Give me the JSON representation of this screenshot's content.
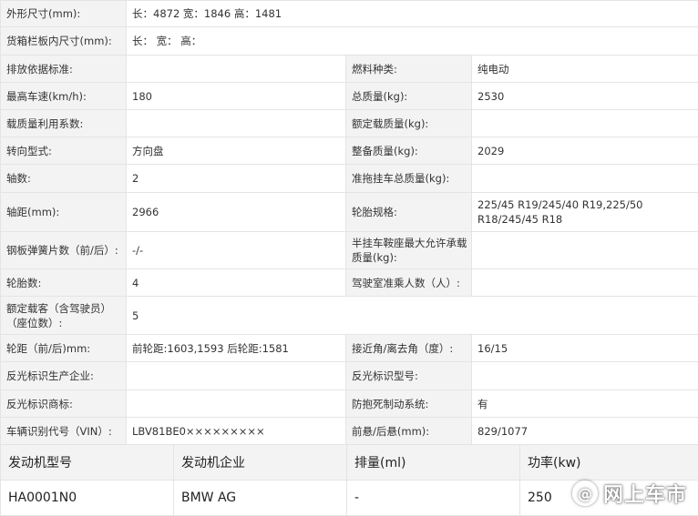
{
  "rows": [
    {
      "k1": "外形尺寸(mm):",
      "v1": "长：4872 宽：1846 高：1481"
    },
    {
      "k1": "货箱栏板内尺寸(mm):",
      "v1": "长： 宽： 高："
    },
    {
      "k1": "排放依据标准:",
      "v1": "",
      "k2": "燃料种类:",
      "v2": "纯电动"
    },
    {
      "k1": "最高车速(km/h):",
      "v1": "180",
      "k2": "总质量(kg):",
      "v2": "2530"
    },
    {
      "k1": "载质量利用系数:",
      "v1": "",
      "k2": "额定载质量(kg):",
      "v2": ""
    },
    {
      "k1": "转向型式:",
      "v1": "方向盘",
      "k2": "整备质量(kg):",
      "v2": "2029"
    },
    {
      "k1": "轴数:",
      "v1": "2",
      "k2": "准拖挂车总质量(kg):",
      "v2": ""
    },
    {
      "k1": "轴距(mm):",
      "v1": "2966",
      "k2": "轮胎规格:",
      "v2": "225/45 R19/245/40 R19,225/50 R18/245/45 R18"
    },
    {
      "k1": "钢板弹簧片数（前/后）:",
      "v1": "-/-",
      "k2": "半挂车鞍座最大允许承载质量(kg):",
      "v2": ""
    },
    {
      "k1": "轮胎数:",
      "v1": "4",
      "k2": "驾驶室准乘人数（人）:",
      "v2": ""
    },
    {
      "k1": "额定载客（含驾驶员）（座位数）:",
      "v1": "5"
    },
    {
      "k1": "轮距（前/后)mm:",
      "v1": "前轮距:1603,1593 后轮距:1581",
      "k2": "接近角/离去角（度）:",
      "v2": "16/15"
    },
    {
      "k1": "反光标识生产企业:",
      "v1": "",
      "k2": "反光标识型号:",
      "v2": ""
    },
    {
      "k1": "反光标识商标:",
      "v1": "",
      "k2": "防抱死制动系统:",
      "v2": "有"
    },
    {
      "k1": "车辆识别代号（VIN）:",
      "v1": "LBV81BE0×××××××××",
      "k2": "前悬/后悬(mm):",
      "v2": "829/1077"
    }
  ],
  "engine": {
    "headers": [
      "发动机型号",
      "发动机企业",
      "排量(ml)",
      "功率(kw)"
    ],
    "values": [
      "HA0001N0",
      "BMW AG",
      "-",
      "250"
    ]
  },
  "watermark": {
    "icon": "@",
    "text": "网上车市"
  }
}
